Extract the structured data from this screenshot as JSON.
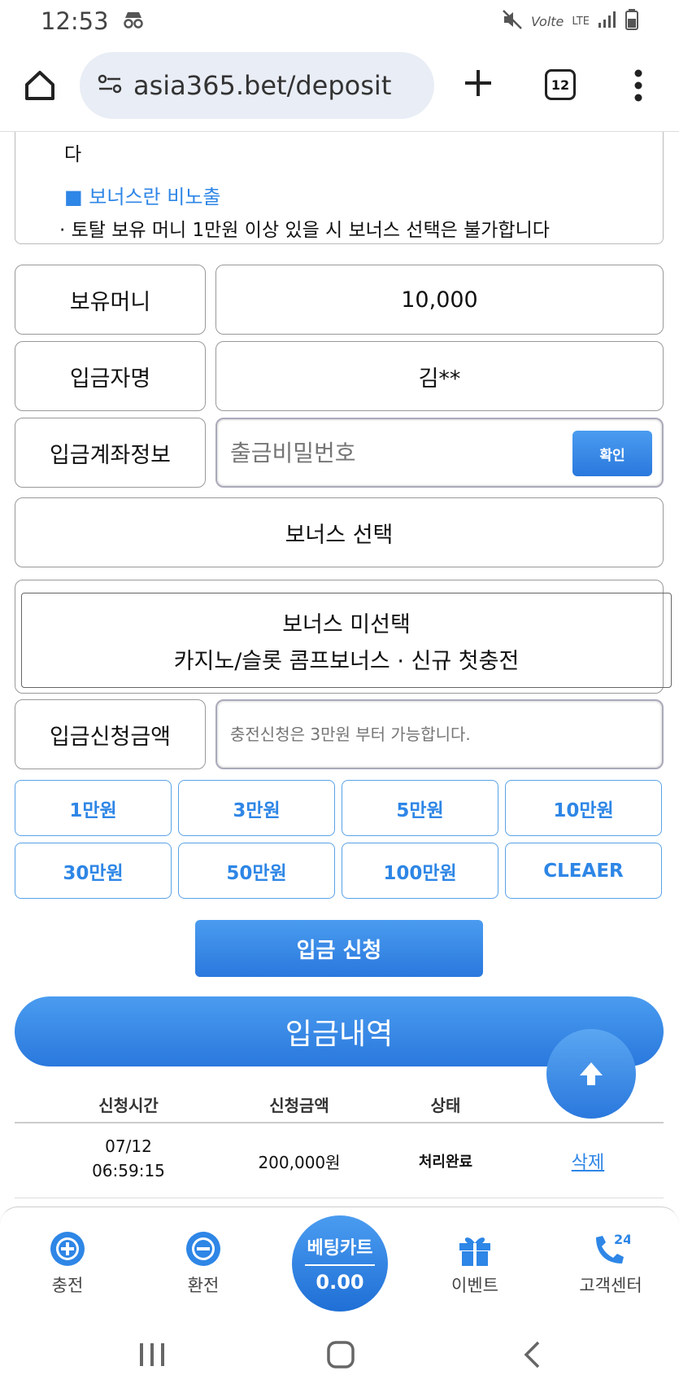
{
  "status_bar": {
    "time": "12:53",
    "network": "LTE"
  },
  "browser": {
    "url": "asia365.bet/deposit",
    "tab_count": "12"
  },
  "notice": {
    "fragment": "다",
    "heading": "■ 보너스란 비노출",
    "line": "· 토탈 보유 머니 1만원 이상 있을 시 보너스 선택은 불가합니다"
  },
  "form": {
    "balance_label": "보유머니",
    "balance_value": "10,000",
    "depositor_label": "입금자명",
    "depositor_value": "김**",
    "account_label": "입금계좌정보",
    "password_placeholder": "출금비밀번호",
    "confirm_label": "확인",
    "bonus_select_label": "보너스 선택",
    "bonus_option_line1": "보너스 미선택",
    "bonus_option_line2": "카지노/슬롯 콤프보너스 · 신규 첫충전",
    "amount_label": "입금신청금액",
    "amount_placeholder": "충전신청은 3만원 부터 가능합니다.",
    "amount_buttons": [
      "1만원",
      "3만원",
      "5만원",
      "10만원",
      "30만원",
      "50만원",
      "100만원",
      "CLEAER"
    ],
    "submit_label": "입금 신청"
  },
  "history": {
    "title": "입금내역",
    "columns": [
      "신청시간",
      "신청금액",
      "상태"
    ],
    "rows": [
      {
        "date": "07/12",
        "time": "06:59:15",
        "amount": "200,000원",
        "status": "처리완료",
        "action": "삭제"
      }
    ]
  },
  "bottom_nav": {
    "charge": "충전",
    "exchange": "환전",
    "bet_cart_label": "베팅카트",
    "bet_cart_value": "0.00",
    "event": "이벤트",
    "support": "고객센터"
  },
  "colors": {
    "accent": "#2e86e6",
    "accent_dark": "#2a78dd"
  }
}
